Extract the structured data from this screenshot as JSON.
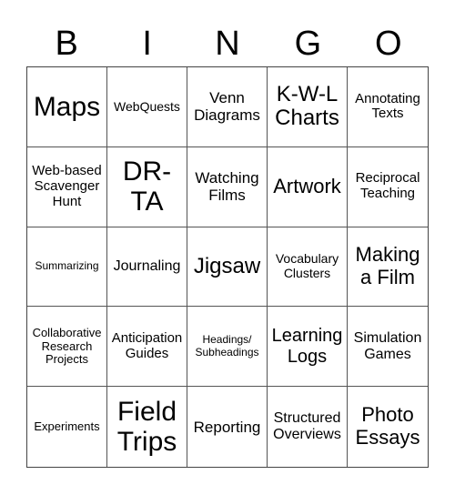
{
  "header": {
    "letters": [
      "B",
      "I",
      "N",
      "G",
      "O"
    ]
  },
  "cells": [
    [
      "Maps",
      "WebQuests",
      "Venn Diagrams",
      "K-W-L Charts",
      "Annotating Texts"
    ],
    [
      "Web-based Scavenger Hunt",
      "DR-TA",
      "Watching Films",
      "Artwork",
      "Reciprocal Teaching"
    ],
    [
      "Summarizing",
      "Journaling",
      "Jigsaw",
      "Vocabulary Clusters",
      "Making a Film"
    ],
    [
      "Collaborative Research Projects",
      "Anticipation Guides",
      "Headings/ Subheadings",
      "Learning Logs",
      "Simulation Games"
    ],
    [
      "Experiments",
      "Field Trips",
      "Reporting",
      "Structured Overviews",
      "Photo Essays"
    ]
  ]
}
